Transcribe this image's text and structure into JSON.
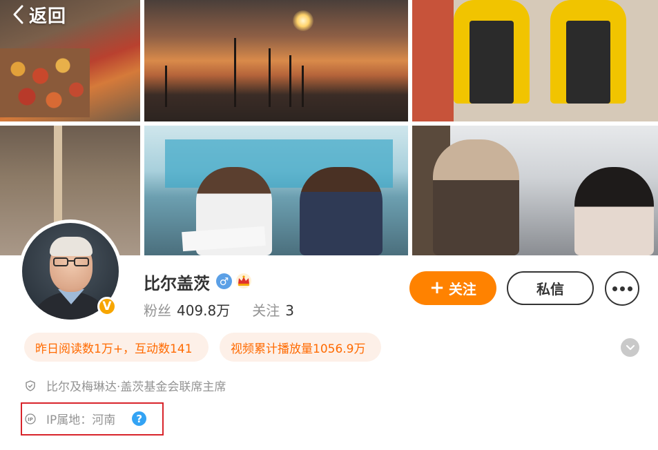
{
  "header": {
    "back_label": "返回",
    "back_icon": "chevron-left-icon"
  },
  "cover": {
    "photos": [
      "cover-photo-market",
      "cover-photo-fire",
      "cover-photo-lab",
      "cover-photo-field",
      "cover-photo-classroom",
      "cover-photo-visit"
    ]
  },
  "profile": {
    "name": "比尔盖茨",
    "gender_symbol": "♂",
    "verified_badge": "V",
    "stats": {
      "followers_label": "粉丝",
      "followers_value": "409.8万",
      "following_label": "关注",
      "following_value": "3"
    }
  },
  "actions": {
    "follow_plus": "+",
    "follow_label": "关注",
    "message_label": "私信",
    "more_icon": "more-dots-icon"
  },
  "chips": {
    "reading": "昨日阅读数1万+，互动数141",
    "video": "视频累计播放量1056.9万"
  },
  "details": {
    "description": "比尔及梅琳达·盖茨基金会联席主席",
    "ip_location": "IP属地：河南",
    "help_symbol": "?"
  },
  "colors": {
    "accent_orange": "#ff8200",
    "chip_bg": "#fdf0e8",
    "chip_text": "#ff6a00",
    "verified_gold": "#f7a600",
    "gender_blue": "#5ba0e6",
    "help_blue": "#33a3f4",
    "highlight_red": "#d8232a",
    "muted_text": "#939393"
  }
}
